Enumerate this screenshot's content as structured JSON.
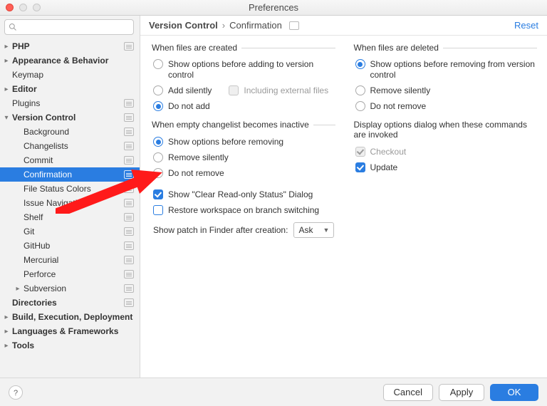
{
  "window": {
    "title": "Preferences"
  },
  "sidebar": {
    "search_placeholder": "",
    "items": [
      {
        "label": "PHP",
        "level": 1,
        "bold": true,
        "arrow": "right",
        "badge": true
      },
      {
        "label": "Appearance & Behavior",
        "level": 1,
        "bold": true,
        "arrow": "right"
      },
      {
        "label": "Keymap",
        "level": 1
      },
      {
        "label": "Editor",
        "level": 1,
        "bold": true,
        "arrow": "right"
      },
      {
        "label": "Plugins",
        "level": 1,
        "badge": true
      },
      {
        "label": "Version Control",
        "level": 1,
        "bold": true,
        "arrow": "down",
        "badge": true
      },
      {
        "label": "Background",
        "level": 2,
        "badge": true
      },
      {
        "label": "Changelists",
        "level": 2,
        "badge": true
      },
      {
        "label": "Commit",
        "level": 2,
        "badge": true
      },
      {
        "label": "Confirmation",
        "level": 2,
        "badge": true,
        "selected": true
      },
      {
        "label": "File Status Colors",
        "level": 2,
        "badge": true
      },
      {
        "label": "Issue Navigation",
        "level": 2,
        "badge": true
      },
      {
        "label": "Shelf",
        "level": 2,
        "badge": true
      },
      {
        "label": "Git",
        "level": 2,
        "badge": true
      },
      {
        "label": "GitHub",
        "level": 2,
        "badge": true
      },
      {
        "label": "Mercurial",
        "level": 2,
        "badge": true
      },
      {
        "label": "Perforce",
        "level": 2,
        "badge": true
      },
      {
        "label": "Subversion",
        "level": 2,
        "arrow": "right",
        "badge": true
      },
      {
        "label": "Directories",
        "level": 1,
        "bold": true,
        "badge": true
      },
      {
        "label": "Build, Execution, Deployment",
        "level": 1,
        "bold": true,
        "arrow": "right"
      },
      {
        "label": "Languages & Frameworks",
        "level": 1,
        "bold": true,
        "arrow": "right"
      },
      {
        "label": "Tools",
        "level": 1,
        "bold": true,
        "arrow": "right"
      }
    ]
  },
  "header": {
    "breadcrumb": [
      "Version Control",
      "Confirmation"
    ],
    "reset": "Reset"
  },
  "groups": {
    "created": {
      "legend": "When files are created",
      "opts": [
        "Show options before adding to version control",
        "Add silently",
        "Do not add"
      ],
      "selected": 2,
      "extra_check": "Including external files"
    },
    "deleted": {
      "legend": "When files are deleted",
      "opts": [
        "Show options before removing from version control",
        "Remove silently",
        "Do not remove"
      ],
      "selected": 0
    },
    "inactive": {
      "legend": "When empty changelist becomes inactive",
      "opts": [
        "Show options before removing",
        "Remove silently",
        "Do not remove"
      ],
      "selected": 0
    },
    "display_dialog": {
      "legend": "Display options dialog when these commands are invoked",
      "checkout": "Checkout",
      "update": "Update"
    }
  },
  "checks": {
    "clear_ro": "Show \"Clear Read-only Status\" Dialog",
    "restore_ws": "Restore workspace on branch switching"
  },
  "patch": {
    "label": "Show patch in Finder after creation:",
    "value": "Ask"
  },
  "footer": {
    "cancel": "Cancel",
    "apply": "Apply",
    "ok": "OK"
  }
}
